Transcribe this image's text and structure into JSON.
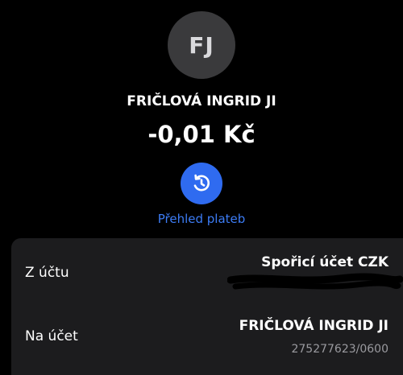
{
  "contact": {
    "initials": "FJ",
    "name": "FRIČLOVÁ INGRID JI"
  },
  "transaction": {
    "amount": "-0,01 Kč"
  },
  "history": {
    "icon": "history-icon",
    "label": "Přehled plateb"
  },
  "details": {
    "from_label": "Z účtu",
    "from_value": "Spořicí účet CZK",
    "to_label": "Na účet",
    "to_name": "FRIČLOVÁ INGRID JI",
    "to_account": "275277623/0600"
  },
  "colors": {
    "background": "#000000",
    "card": "#1c1c1e",
    "avatar": "#3a3a3c",
    "accent": "#2f6bf0",
    "link": "#3c7cf5",
    "secondary_text": "#9a9a9f"
  }
}
